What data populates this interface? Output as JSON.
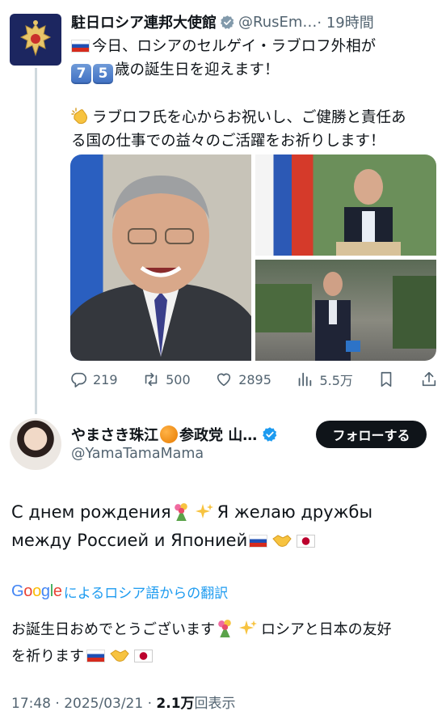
{
  "parent_tweet": {
    "author_name": "駐日ロシア連邦大使館",
    "handle": "@RusEm…",
    "time": "· 19時間",
    "text_line1": "今日、ロシアのセルゲイ・ラブロフ外相が",
    "age_digit_1": "7",
    "age_digit_2": "5",
    "text_line2": "歳の誕生日を迎えます！",
    "text_line3": "ラブロフ氏を心からお祝いし、ご健勝と責任あ",
    "text_line4": "る国の仕事での益々のご活躍をお祈りします！",
    "stats": {
      "replies": "219",
      "reposts": "500",
      "likes": "2895",
      "views": "5.5万"
    }
  },
  "reply_tweet": {
    "author_name_a": "やまさき珠江",
    "author_name_b": "参政党 山…",
    "handle": "@YamaTamaMama",
    "follow_label": "フォローする",
    "body_line1a": "С днем рождения",
    "body_line1b": "Я желаю дружбы",
    "body_line2": "между Россией и Японией",
    "translation_brand": "Google",
    "translation_label": "によるロシア語からの翻訳",
    "translated_line1a": "お誕生日おめでとうございます",
    "translated_line1b": "ロシアと日本の友好",
    "translated_line2": "を祈ります",
    "time": "17:48 · 2025/03/21 ·",
    "views_count": "2.1万",
    "views_label": "回表示"
  },
  "colors": {
    "accent_blue": "#1d9bf0",
    "text_secondary": "#536471",
    "verified_gray": "#829aab",
    "follow_button": "#0f1419"
  },
  "icons": [
    "reply-icon",
    "repost-icon",
    "like-icon",
    "views-icon",
    "bookmark-icon",
    "share-icon",
    "verified-badge-icon"
  ]
}
